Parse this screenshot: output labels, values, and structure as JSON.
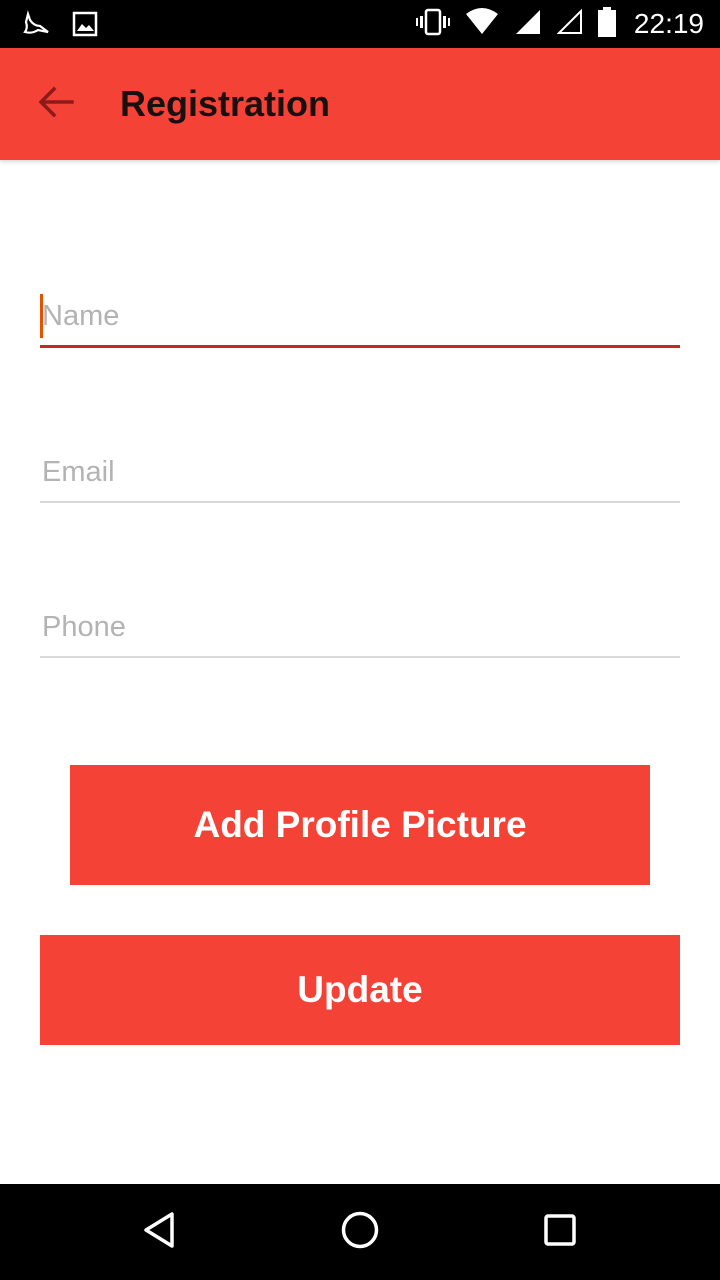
{
  "status_bar": {
    "time": "22:19",
    "left_icons": [
      "bird-icon",
      "image-icon"
    ],
    "right_icons": [
      "vibrate-icon",
      "wifi-icon",
      "signal-icon",
      "signal-empty-icon",
      "battery-icon"
    ]
  },
  "app_bar": {
    "title": "Registration",
    "back_icon": "arrow-back-icon",
    "color": "#f44336"
  },
  "form": {
    "name": {
      "placeholder": "Name",
      "value": ""
    },
    "email": {
      "placeholder": "Email",
      "value": ""
    },
    "phone": {
      "placeholder": "Phone",
      "value": ""
    }
  },
  "buttons": {
    "add_picture": "Add Profile Picture",
    "update": "Update"
  },
  "nav_bar": {
    "icons": [
      "back-triangle-icon",
      "home-circle-icon",
      "recents-square-icon"
    ]
  }
}
